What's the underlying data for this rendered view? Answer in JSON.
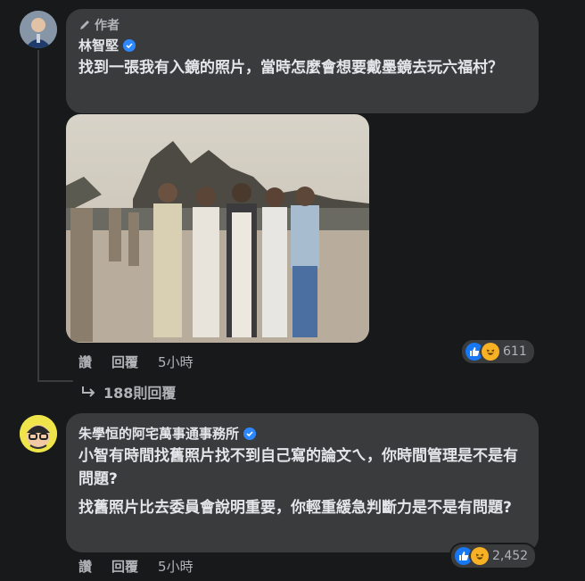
{
  "comment1": {
    "author_badge": "作者",
    "author_name": "林智堅",
    "text": "找到一張我有入鏡的照片，當時怎麼會想要戴墨鏡去玩六福村？",
    "actions": {
      "like": "讚",
      "reply": "回覆",
      "time": "5小時"
    },
    "reaction_count": "611",
    "replies_label": "188則回覆",
    "photo_icon": "group-photo-image",
    "colors": {
      "bubble": "#3a3b3c",
      "background": "#18191a"
    }
  },
  "comment2": {
    "author_name": "朱學恒的阿宅萬事通事務所",
    "paragraph1": "小智有時間找舊照片找不到自己寫的論文ㄟ，你時間管理是不是有問題?",
    "paragraph2": "找舊照片比去委員會說明重要，你輕重緩急判斷力是不是有問題?",
    "actions": {
      "like": "讚",
      "reply": "回覆",
      "time": "5小時"
    },
    "reaction_count": "2,452"
  },
  "icons": {
    "author_badge_icon": "pencil-icon",
    "verified_icon": "verified-badge-icon",
    "reply_arrow_icon": "reply-arrow-icon",
    "like_reaction": "like-reaction-icon",
    "haha_reaction": "haha-reaction-icon"
  },
  "accent": "#2d88ff"
}
